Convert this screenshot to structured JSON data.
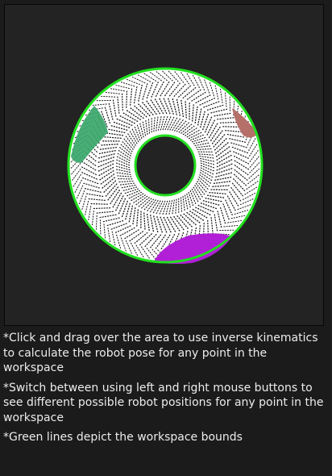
{
  "workspace": {
    "colors": {
      "background": "#232323",
      "bounds": "#22e01f",
      "fill": "#ffffff",
      "hatch": "#1a1a1a",
      "reach_green": "#3aa66a",
      "reach_red": "#b5706a",
      "reach_purple": "#b11fd6"
    }
  },
  "instructions": [
    "*Click and drag over the area to use inverse kinematics to calculate the robot pose for any point in the workspace",
    "*Switch between using left and right mouse buttons to see different possible robot positions for any point in the workspace",
    "*Green lines depict the workspace bounds"
  ]
}
